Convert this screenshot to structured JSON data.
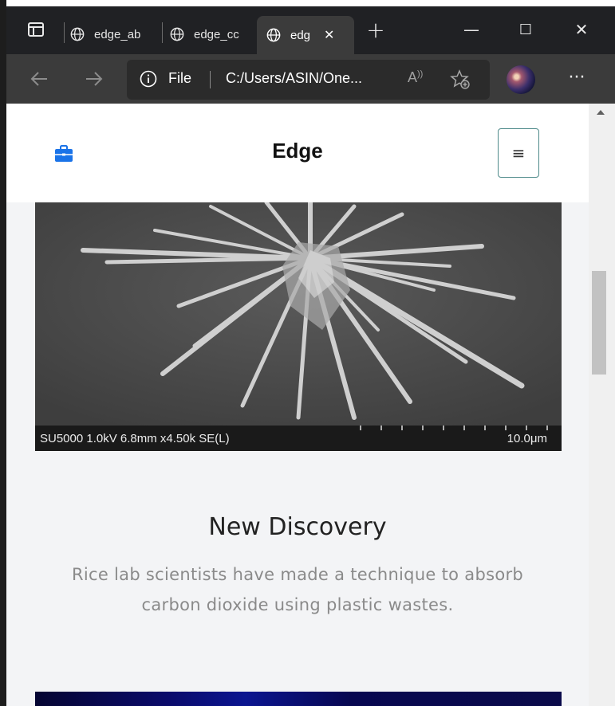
{
  "browser": {
    "tabs": [
      {
        "label": "edge_ab",
        "active": false
      },
      {
        "label": "edge_cc",
        "active": false
      },
      {
        "label": "edg",
        "active": true
      }
    ],
    "close_tab": "✕",
    "new_tab": "+",
    "address": {
      "scheme_label": "File",
      "path": "C:/Users/ASIN/One...",
      "read_aloud": "A)"
    },
    "window_controls": {
      "minimize": "—",
      "maximize": "☐",
      "close": "✕"
    },
    "more": "···"
  },
  "site": {
    "brand": "Edge",
    "toggler_icon": "≡",
    "accent_color": "#1a73e8"
  },
  "hero": {
    "sem_info": "SU5000 1.0kV 6.8mm x4.50k SE(L)",
    "scale_label": "10.0μm"
  },
  "section": {
    "title": "New Discovery",
    "text": "Rice lab scientists have made a technique to absorb carbon dioxide using plastic wastes."
  }
}
